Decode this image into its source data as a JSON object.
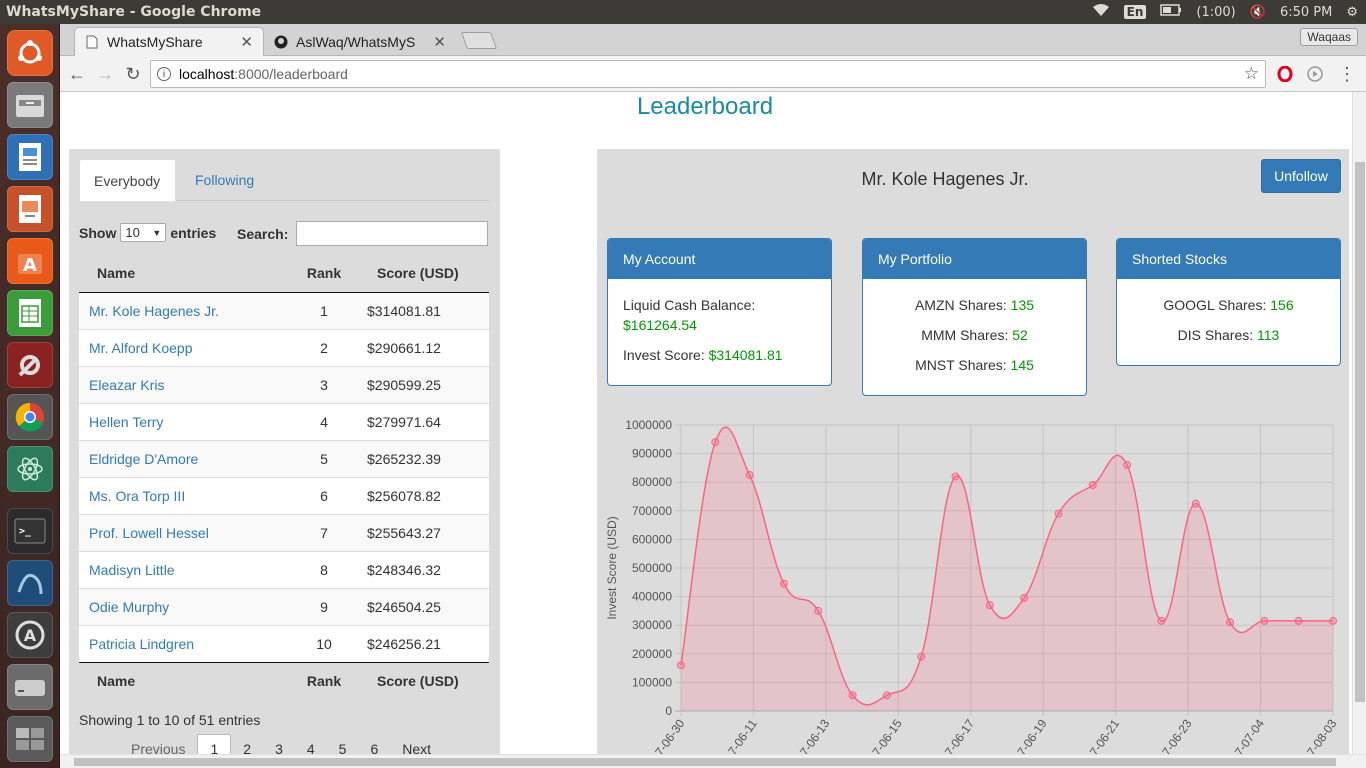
{
  "os": {
    "window_title": "WhatsMyShare - Google Chrome",
    "keyboard": "En",
    "battery": "(1:00)",
    "clock": "6:50 PM"
  },
  "browser": {
    "tabs": [
      {
        "title": "WhatsMyShare",
        "active": true
      },
      {
        "title": "AslWaq/WhatsMyS",
        "active": false
      }
    ],
    "profile": "Waqaas",
    "url_host": "localhost",
    "url_rest": ":8000/leaderboard"
  },
  "page": {
    "title": "Leaderboard",
    "tabs": {
      "everybody": "Everybody",
      "following": "Following"
    },
    "table_controls": {
      "show": "Show",
      "entries_value": "10",
      "entries": "entries",
      "search": "Search:"
    },
    "columns": {
      "name": "Name",
      "rank": "Rank",
      "score": "Score (USD)"
    },
    "rows": [
      {
        "name": "Mr. Kole Hagenes Jr.",
        "rank": "1",
        "score": "$314081.81"
      },
      {
        "name": "Mr. Alford Koepp",
        "rank": "2",
        "score": "$290661.12"
      },
      {
        "name": "Eleazar Kris",
        "rank": "3",
        "score": "$290599.25"
      },
      {
        "name": "Hellen Terry",
        "rank": "4",
        "score": "$279971.64"
      },
      {
        "name": "Eldridge D'Amore",
        "rank": "5",
        "score": "$265232.39"
      },
      {
        "name": "Ms. Ora Torp III",
        "rank": "6",
        "score": "$256078.82"
      },
      {
        "name": "Prof. Lowell Hessel",
        "rank": "7",
        "score": "$255643.27"
      },
      {
        "name": "Madisyn Little",
        "rank": "8",
        "score": "$248346.32"
      },
      {
        "name": "Odie Murphy",
        "rank": "9",
        "score": "$246504.25"
      },
      {
        "name": "Patricia Lindgren",
        "rank": "10",
        "score": "$246256.21"
      }
    ],
    "info": "Showing 1 to 10 of 51 entries",
    "pagination": {
      "previous": "Previous",
      "pages": [
        "1",
        "2",
        "3",
        "4",
        "5",
        "6"
      ],
      "next": "Next"
    },
    "profile": {
      "name": "Mr. Kole Hagenes Jr.",
      "unfollow": "Unfollow",
      "account": {
        "title": "My Account",
        "cash_label": "Liquid Cash Balance:",
        "cash_value": "$161264.54",
        "score_label": "Invest Score:",
        "score_value": "$314081.81"
      },
      "portfolio": {
        "title": "My Portfolio",
        "items": [
          {
            "label": "AMZN Shares:",
            "value": "135"
          },
          {
            "label": "MMM Shares:",
            "value": "52"
          },
          {
            "label": "MNST Shares:",
            "value": "145"
          }
        ]
      },
      "shorted": {
        "title": "Shorted Stocks",
        "items": [
          {
            "label": "GOOGL Shares:",
            "value": "156"
          },
          {
            "label": "DIS Shares:",
            "value": "113"
          }
        ]
      }
    }
  },
  "colors": {
    "link": "#337ab7",
    "primary": "#337ab7",
    "positive": "#009900",
    "chart_line": "#ff6384",
    "chart_fill": "rgba(255,99,132,0.2)"
  },
  "chart_data": {
    "type": "area",
    "ylabel": "Invest Score (USD)",
    "ylim": [
      0,
      1000000
    ],
    "yticks": [
      "0",
      "100000",
      "200000",
      "300000",
      "400000",
      "500000",
      "600000",
      "700000",
      "800000",
      "900000",
      "1000000"
    ],
    "xtick_labels": [
      "7-06-30",
      "7-06-11",
      "7-06-13",
      "7-06-15",
      "7-06-17",
      "7-06-19",
      "7-06-21",
      "7-06-23",
      "7-07-04",
      "7-08-03"
    ],
    "values": [
      160000,
      940000,
      825000,
      445000,
      350000,
      55000,
      55000,
      190000,
      820000,
      370000,
      395000,
      690000,
      790000,
      860000,
      315000,
      725000,
      310000,
      315000,
      315000,
      315000
    ],
    "grid": true,
    "legend": "none"
  }
}
